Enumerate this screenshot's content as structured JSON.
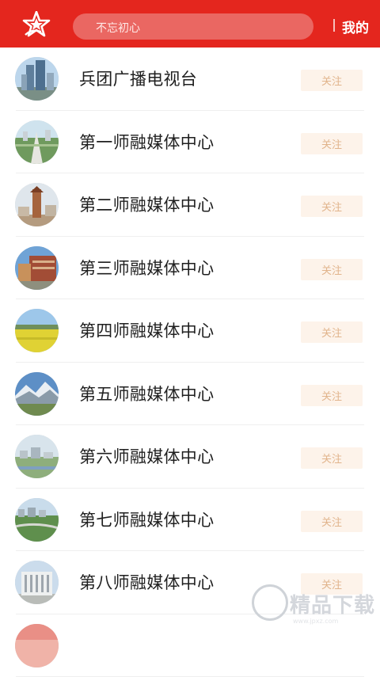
{
  "header": {
    "search_placeholder": "不忘初心",
    "mine_label": "我的"
  },
  "follow_label": "关注",
  "items": [
    {
      "name": "兵团广播电视台"
    },
    {
      "name": "第一师融媒体中心"
    },
    {
      "name": "第二师融媒体中心"
    },
    {
      "name": "第三师融媒体中心"
    },
    {
      "name": "第四师融媒体中心"
    },
    {
      "name": "第五师融媒体中心"
    },
    {
      "name": "第六师融媒体中心"
    },
    {
      "name": "第七师融媒体中心"
    },
    {
      "name": "第八师融媒体中心"
    },
    {
      "name": ""
    }
  ],
  "watermark": {
    "text": "精品下载",
    "sub": "www.jpxz.com"
  },
  "colors": {
    "header_bg": "#e4261e",
    "follow_bg": "#fdf3ea",
    "follow_text": "#e1b48c"
  }
}
